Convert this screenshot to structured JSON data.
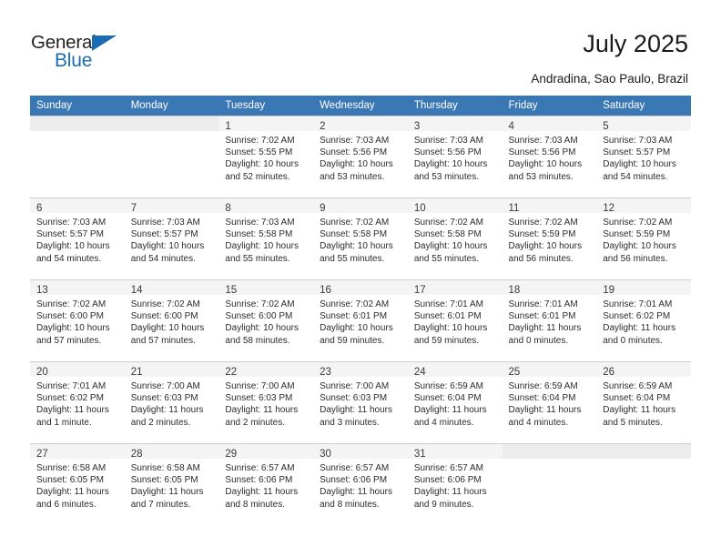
{
  "brand": {
    "name_part1": "General",
    "name_part2": "Blue",
    "accent_color": "#1c6cb3",
    "triangle_icon": "triangle-icon"
  },
  "header": {
    "title": "July 2025",
    "subtitle": "Andradina, Sao Paulo, Brazil"
  },
  "calendar": {
    "header_bg": "#3a77b5",
    "weekday_headers": [
      "Sunday",
      "Monday",
      "Tuesday",
      "Wednesday",
      "Thursday",
      "Friday",
      "Saturday"
    ],
    "weeks": [
      [
        {
          "day": "",
          "sunrise": "",
          "sunset": "",
          "daylight_line1": "",
          "daylight_line2": ""
        },
        {
          "day": "",
          "sunrise": "",
          "sunset": "",
          "daylight_line1": "",
          "daylight_line2": ""
        },
        {
          "day": "1",
          "sunrise": "Sunrise: 7:02 AM",
          "sunset": "Sunset: 5:55 PM",
          "daylight_line1": "Daylight: 10 hours",
          "daylight_line2": "and 52 minutes."
        },
        {
          "day": "2",
          "sunrise": "Sunrise: 7:03 AM",
          "sunset": "Sunset: 5:56 PM",
          "daylight_line1": "Daylight: 10 hours",
          "daylight_line2": "and 53 minutes."
        },
        {
          "day": "3",
          "sunrise": "Sunrise: 7:03 AM",
          "sunset": "Sunset: 5:56 PM",
          "daylight_line1": "Daylight: 10 hours",
          "daylight_line2": "and 53 minutes."
        },
        {
          "day": "4",
          "sunrise": "Sunrise: 7:03 AM",
          "sunset": "Sunset: 5:56 PM",
          "daylight_line1": "Daylight: 10 hours",
          "daylight_line2": "and 53 minutes."
        },
        {
          "day": "5",
          "sunrise": "Sunrise: 7:03 AM",
          "sunset": "Sunset: 5:57 PM",
          "daylight_line1": "Daylight: 10 hours",
          "daylight_line2": "and 54 minutes."
        }
      ],
      [
        {
          "day": "6",
          "sunrise": "Sunrise: 7:03 AM",
          "sunset": "Sunset: 5:57 PM",
          "daylight_line1": "Daylight: 10 hours",
          "daylight_line2": "and 54 minutes."
        },
        {
          "day": "7",
          "sunrise": "Sunrise: 7:03 AM",
          "sunset": "Sunset: 5:57 PM",
          "daylight_line1": "Daylight: 10 hours",
          "daylight_line2": "and 54 minutes."
        },
        {
          "day": "8",
          "sunrise": "Sunrise: 7:03 AM",
          "sunset": "Sunset: 5:58 PM",
          "daylight_line1": "Daylight: 10 hours",
          "daylight_line2": "and 55 minutes."
        },
        {
          "day": "9",
          "sunrise": "Sunrise: 7:02 AM",
          "sunset": "Sunset: 5:58 PM",
          "daylight_line1": "Daylight: 10 hours",
          "daylight_line2": "and 55 minutes."
        },
        {
          "day": "10",
          "sunrise": "Sunrise: 7:02 AM",
          "sunset": "Sunset: 5:58 PM",
          "daylight_line1": "Daylight: 10 hours",
          "daylight_line2": "and 55 minutes."
        },
        {
          "day": "11",
          "sunrise": "Sunrise: 7:02 AM",
          "sunset": "Sunset: 5:59 PM",
          "daylight_line1": "Daylight: 10 hours",
          "daylight_line2": "and 56 minutes."
        },
        {
          "day": "12",
          "sunrise": "Sunrise: 7:02 AM",
          "sunset": "Sunset: 5:59 PM",
          "daylight_line1": "Daylight: 10 hours",
          "daylight_line2": "and 56 minutes."
        }
      ],
      [
        {
          "day": "13",
          "sunrise": "Sunrise: 7:02 AM",
          "sunset": "Sunset: 6:00 PM",
          "daylight_line1": "Daylight: 10 hours",
          "daylight_line2": "and 57 minutes."
        },
        {
          "day": "14",
          "sunrise": "Sunrise: 7:02 AM",
          "sunset": "Sunset: 6:00 PM",
          "daylight_line1": "Daylight: 10 hours",
          "daylight_line2": "and 57 minutes."
        },
        {
          "day": "15",
          "sunrise": "Sunrise: 7:02 AM",
          "sunset": "Sunset: 6:00 PM",
          "daylight_line1": "Daylight: 10 hours",
          "daylight_line2": "and 58 minutes."
        },
        {
          "day": "16",
          "sunrise": "Sunrise: 7:02 AM",
          "sunset": "Sunset: 6:01 PM",
          "daylight_line1": "Daylight: 10 hours",
          "daylight_line2": "and 59 minutes."
        },
        {
          "day": "17",
          "sunrise": "Sunrise: 7:01 AM",
          "sunset": "Sunset: 6:01 PM",
          "daylight_line1": "Daylight: 10 hours",
          "daylight_line2": "and 59 minutes."
        },
        {
          "day": "18",
          "sunrise": "Sunrise: 7:01 AM",
          "sunset": "Sunset: 6:01 PM",
          "daylight_line1": "Daylight: 11 hours",
          "daylight_line2": "and 0 minutes."
        },
        {
          "day": "19",
          "sunrise": "Sunrise: 7:01 AM",
          "sunset": "Sunset: 6:02 PM",
          "daylight_line1": "Daylight: 11 hours",
          "daylight_line2": "and 0 minutes."
        }
      ],
      [
        {
          "day": "20",
          "sunrise": "Sunrise: 7:01 AM",
          "sunset": "Sunset: 6:02 PM",
          "daylight_line1": "Daylight: 11 hours",
          "daylight_line2": "and 1 minute."
        },
        {
          "day": "21",
          "sunrise": "Sunrise: 7:00 AM",
          "sunset": "Sunset: 6:03 PM",
          "daylight_line1": "Daylight: 11 hours",
          "daylight_line2": "and 2 minutes."
        },
        {
          "day": "22",
          "sunrise": "Sunrise: 7:00 AM",
          "sunset": "Sunset: 6:03 PM",
          "daylight_line1": "Daylight: 11 hours",
          "daylight_line2": "and 2 minutes."
        },
        {
          "day": "23",
          "sunrise": "Sunrise: 7:00 AM",
          "sunset": "Sunset: 6:03 PM",
          "daylight_line1": "Daylight: 11 hours",
          "daylight_line2": "and 3 minutes."
        },
        {
          "day": "24",
          "sunrise": "Sunrise: 6:59 AM",
          "sunset": "Sunset: 6:04 PM",
          "daylight_line1": "Daylight: 11 hours",
          "daylight_line2": "and 4 minutes."
        },
        {
          "day": "25",
          "sunrise": "Sunrise: 6:59 AM",
          "sunset": "Sunset: 6:04 PM",
          "daylight_line1": "Daylight: 11 hours",
          "daylight_line2": "and 4 minutes."
        },
        {
          "day": "26",
          "sunrise": "Sunrise: 6:59 AM",
          "sunset": "Sunset: 6:04 PM",
          "daylight_line1": "Daylight: 11 hours",
          "daylight_line2": "and 5 minutes."
        }
      ],
      [
        {
          "day": "27",
          "sunrise": "Sunrise: 6:58 AM",
          "sunset": "Sunset: 6:05 PM",
          "daylight_line1": "Daylight: 11 hours",
          "daylight_line2": "and 6 minutes."
        },
        {
          "day": "28",
          "sunrise": "Sunrise: 6:58 AM",
          "sunset": "Sunset: 6:05 PM",
          "daylight_line1": "Daylight: 11 hours",
          "daylight_line2": "and 7 minutes."
        },
        {
          "day": "29",
          "sunrise": "Sunrise: 6:57 AM",
          "sunset": "Sunset: 6:06 PM",
          "daylight_line1": "Daylight: 11 hours",
          "daylight_line2": "and 8 minutes."
        },
        {
          "day": "30",
          "sunrise": "Sunrise: 6:57 AM",
          "sunset": "Sunset: 6:06 PM",
          "daylight_line1": "Daylight: 11 hours",
          "daylight_line2": "and 8 minutes."
        },
        {
          "day": "31",
          "sunrise": "Sunrise: 6:57 AM",
          "sunset": "Sunset: 6:06 PM",
          "daylight_line1": "Daylight: 11 hours",
          "daylight_line2": "and 9 minutes."
        },
        {
          "day": "",
          "sunrise": "",
          "sunset": "",
          "daylight_line1": "",
          "daylight_line2": ""
        },
        {
          "day": "",
          "sunrise": "",
          "sunset": "",
          "daylight_line1": "",
          "daylight_line2": ""
        }
      ]
    ]
  }
}
